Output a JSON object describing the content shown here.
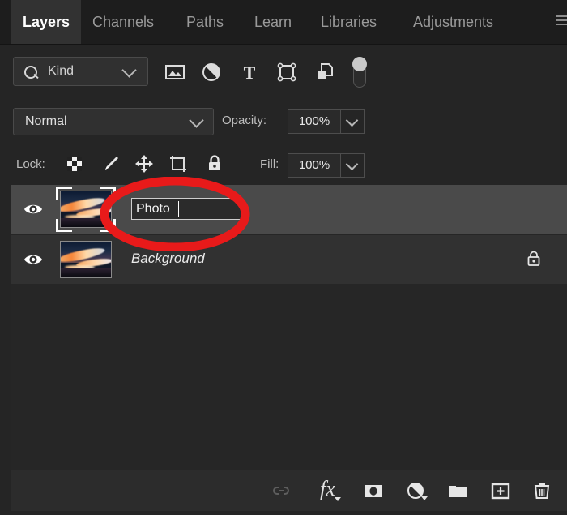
{
  "panel": {
    "title": "Layers",
    "menu_icon": "hamburger-menu-icon"
  },
  "tabs": [
    {
      "label": "Layers",
      "active": true
    },
    {
      "label": "Channels",
      "active": false
    },
    {
      "label": "Paths",
      "active": false
    },
    {
      "label": "Learn",
      "active": false
    },
    {
      "label": "Libraries",
      "active": false
    },
    {
      "label": "Adjustments",
      "active": false
    }
  ],
  "filter_row": {
    "kind_label": "Kind",
    "search_icon": "search-icon",
    "caret_icon": "chevron-down-icon",
    "icons": [
      {
        "name": "filter-pixel-layers-icon"
      },
      {
        "name": "filter-adjustment-layers-icon"
      },
      {
        "name": "filter-type-layers-icon"
      },
      {
        "name": "filter-shape-layers-icon"
      },
      {
        "name": "filter-smart-object-layers-icon"
      }
    ],
    "toggle": {
      "name": "filter-enable-toggle",
      "state": "off"
    }
  },
  "blend_row": {
    "blend_mode": "Normal",
    "opacity_label": "Opacity:",
    "opacity_value": "100%"
  },
  "lock_row": {
    "lock_label": "Lock:",
    "icons": [
      {
        "name": "lock-transparent-pixels-icon"
      },
      {
        "name": "lock-image-pixels-icon"
      },
      {
        "name": "lock-position-icon"
      },
      {
        "name": "lock-artboard-nesting-icon"
      },
      {
        "name": "lock-all-icon"
      }
    ],
    "fill_label": "Fill:",
    "fill_value": "100%"
  },
  "layers": [
    {
      "name": "Photo",
      "editing": true,
      "rename_value": "Photo",
      "visible": true,
      "selected": true,
      "locked": false,
      "thumbnail": "sunset-clouds-thumbnail"
    },
    {
      "name": "Background",
      "editing": false,
      "rename_value": "",
      "visible": true,
      "selected": false,
      "locked": true,
      "thumbnail": "sunset-clouds-thumbnail"
    }
  ],
  "bottom_bar": {
    "buttons": [
      {
        "name": "link-layers-button",
        "icon": "link-icon",
        "enabled": false
      },
      {
        "name": "layer-styles-button",
        "icon": "fx-icon",
        "enabled": true
      },
      {
        "name": "add-layer-mask-button",
        "icon": "mask-icon",
        "enabled": true
      },
      {
        "name": "new-adjustment-layer-button",
        "icon": "half-filled-circle-icon",
        "enabled": true
      },
      {
        "name": "new-group-button",
        "icon": "folder-icon",
        "enabled": true
      },
      {
        "name": "new-layer-button",
        "icon": "plus-square-icon",
        "enabled": true
      },
      {
        "name": "delete-layer-button",
        "icon": "trash-icon",
        "enabled": true
      }
    ]
  },
  "annotation": {
    "shape": "ellipse",
    "color": "#e81a1a",
    "target": "layer-rename-input"
  },
  "colors": {
    "panel_bg": "#252525",
    "tabbar_bg": "#1d1d1d",
    "active_tab_bg": "#323232",
    "selected_row_bg": "#4a4a4a",
    "row_bg": "#313131",
    "annotation_red": "#e81a1a"
  }
}
